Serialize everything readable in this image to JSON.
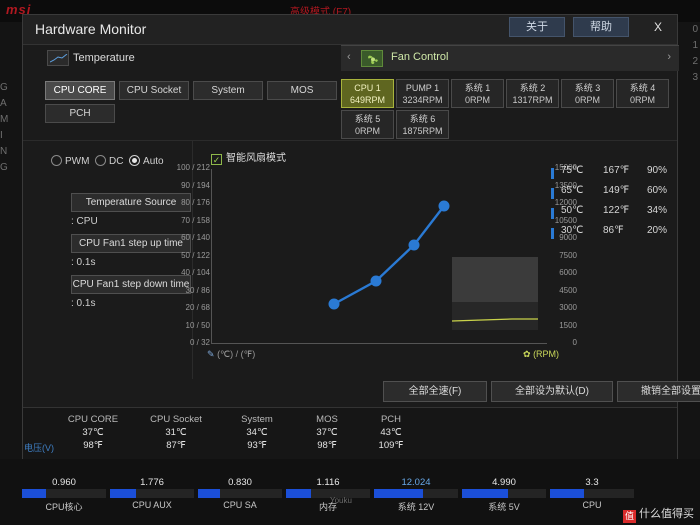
{
  "background": {
    "brand": "msi",
    "mode_label": "高级模式 (F7)",
    "left_labels": [
      "G",
      "A",
      "M",
      "I",
      "N",
      "G"
    ],
    "right_labels": [
      "0",
      "1",
      "2",
      "3"
    ]
  },
  "window": {
    "title": "Hardware Monitor",
    "buttons": {
      "about": "关于",
      "help": "帮助",
      "close": "X"
    }
  },
  "tabs": {
    "temperature": {
      "label": "Temperature",
      "icon": "chart-icon"
    },
    "fan_control": {
      "label": "Fan Control",
      "icon": "fan-icon"
    },
    "prev_arrow": "‹",
    "next_arrow": "›"
  },
  "sensor_buttons": [
    {
      "label": "CPU CORE",
      "selected": true
    },
    {
      "label": "CPU Socket",
      "selected": false
    },
    {
      "label": "System",
      "selected": false
    },
    {
      "label": "MOS",
      "selected": false
    },
    {
      "label": "PCH",
      "selected": false
    }
  ],
  "fan_buttons": [
    {
      "name": "CPU 1",
      "value": "649RPM",
      "selected": true
    },
    {
      "name": "PUMP 1",
      "value": "3234RPM",
      "selected": false
    },
    {
      "name": "系统 1",
      "value": "0RPM",
      "selected": false
    },
    {
      "name": "系统 2",
      "value": "1317RPM",
      "selected": false
    },
    {
      "name": "系统 3",
      "value": "0RPM",
      "selected": false
    },
    {
      "name": "系统 4",
      "value": "0RPM",
      "selected": false
    },
    {
      "name": "系统 5",
      "value": "0RPM",
      "selected": false
    },
    {
      "name": "系统 6",
      "value": "1875RPM",
      "selected": false
    }
  ],
  "left_pane": {
    "modes": [
      {
        "label": "PWM",
        "selected": false
      },
      {
        "label": "DC",
        "selected": false
      },
      {
        "label": "Auto",
        "selected": true
      }
    ],
    "fields": [
      {
        "button": "Temperature Source",
        "value": ": CPU"
      },
      {
        "button": "CPU Fan1 step up time",
        "value": ": 0.1s"
      },
      {
        "button": "CPU Fan1 step down time",
        "value": ": 0.1s"
      }
    ]
  },
  "smart_mode": {
    "label": "智能风扇模式",
    "checked": true
  },
  "chart_data": {
    "type": "line",
    "title": "智能风扇模式",
    "xlabel": "(℃) / (℉)",
    "ylabel": "(RPM)",
    "y_left_labels": [
      "100 / 212",
      "90 / 194",
      "80 / 176",
      "70 / 158",
      "60 / 140",
      "50 / 122",
      "40 / 104",
      "30 / 86",
      "20 / 68",
      "10 / 50",
      "0 / 32"
    ],
    "y_right_labels": [
      "15000",
      "13500",
      "12000",
      "10500",
      "9000",
      "7500",
      "6000",
      "4500",
      "3000",
      "1500",
      "0"
    ],
    "x": [
      30,
      50,
      65,
      75
    ],
    "y": [
      20,
      34,
      60,
      90
    ],
    "point_labels": [
      "20%",
      "34%",
      "60%",
      "90%"
    ],
    "line_color": "#2a7ad4",
    "point_color": "#2a7ad4"
  },
  "legend": [
    {
      "c": "75℃",
      "f": "167℉",
      "p": "90%"
    },
    {
      "c": "65℃",
      "f": "149℉",
      "p": "60%"
    },
    {
      "c": "50℃",
      "f": "122℉",
      "p": "34%"
    },
    {
      "c": "30℃",
      "f": "86℉",
      "p": "20%"
    }
  ],
  "actions": [
    {
      "label": "全部全速(F)"
    },
    {
      "label": "全部设为默认(D)"
    },
    {
      "label": "撤销全部设置(C)"
    }
  ],
  "status": [
    {
      "name": "CPU CORE",
      "c": "37℃",
      "f": "98℉"
    },
    {
      "name": "CPU Socket",
      "c": "31℃",
      "f": "87℉"
    },
    {
      "name": "System",
      "c": "34℃",
      "f": "93℉"
    },
    {
      "name": "MOS",
      "c": "37℃",
      "f": "98℉"
    },
    {
      "name": "PCH",
      "c": "43℃",
      "f": "109℉"
    }
  ],
  "voltage": {
    "title": "电压(V)",
    "items": [
      {
        "value": "0.960",
        "label": "CPU核心",
        "fill": 0.28
      },
      {
        "value": "1.776",
        "label": "CPU AUX",
        "fill": 0.3
      },
      {
        "value": "0.830",
        "label": "CPU SA",
        "fill": 0.26
      },
      {
        "value": "1.116",
        "label": "内存",
        "fill": 0.3
      },
      {
        "value": "12.024",
        "label": "系统 12V",
        "fill": 0.58
      },
      {
        "value": "4.990",
        "label": "系统 5V",
        "fill": 0.55
      },
      {
        "value": "3.3",
        "label": "CPU",
        "fill": 0.4
      }
    ]
  },
  "watermark": {
    "mark": "值",
    "text": "什么值得买"
  },
  "youku": "Youku"
}
